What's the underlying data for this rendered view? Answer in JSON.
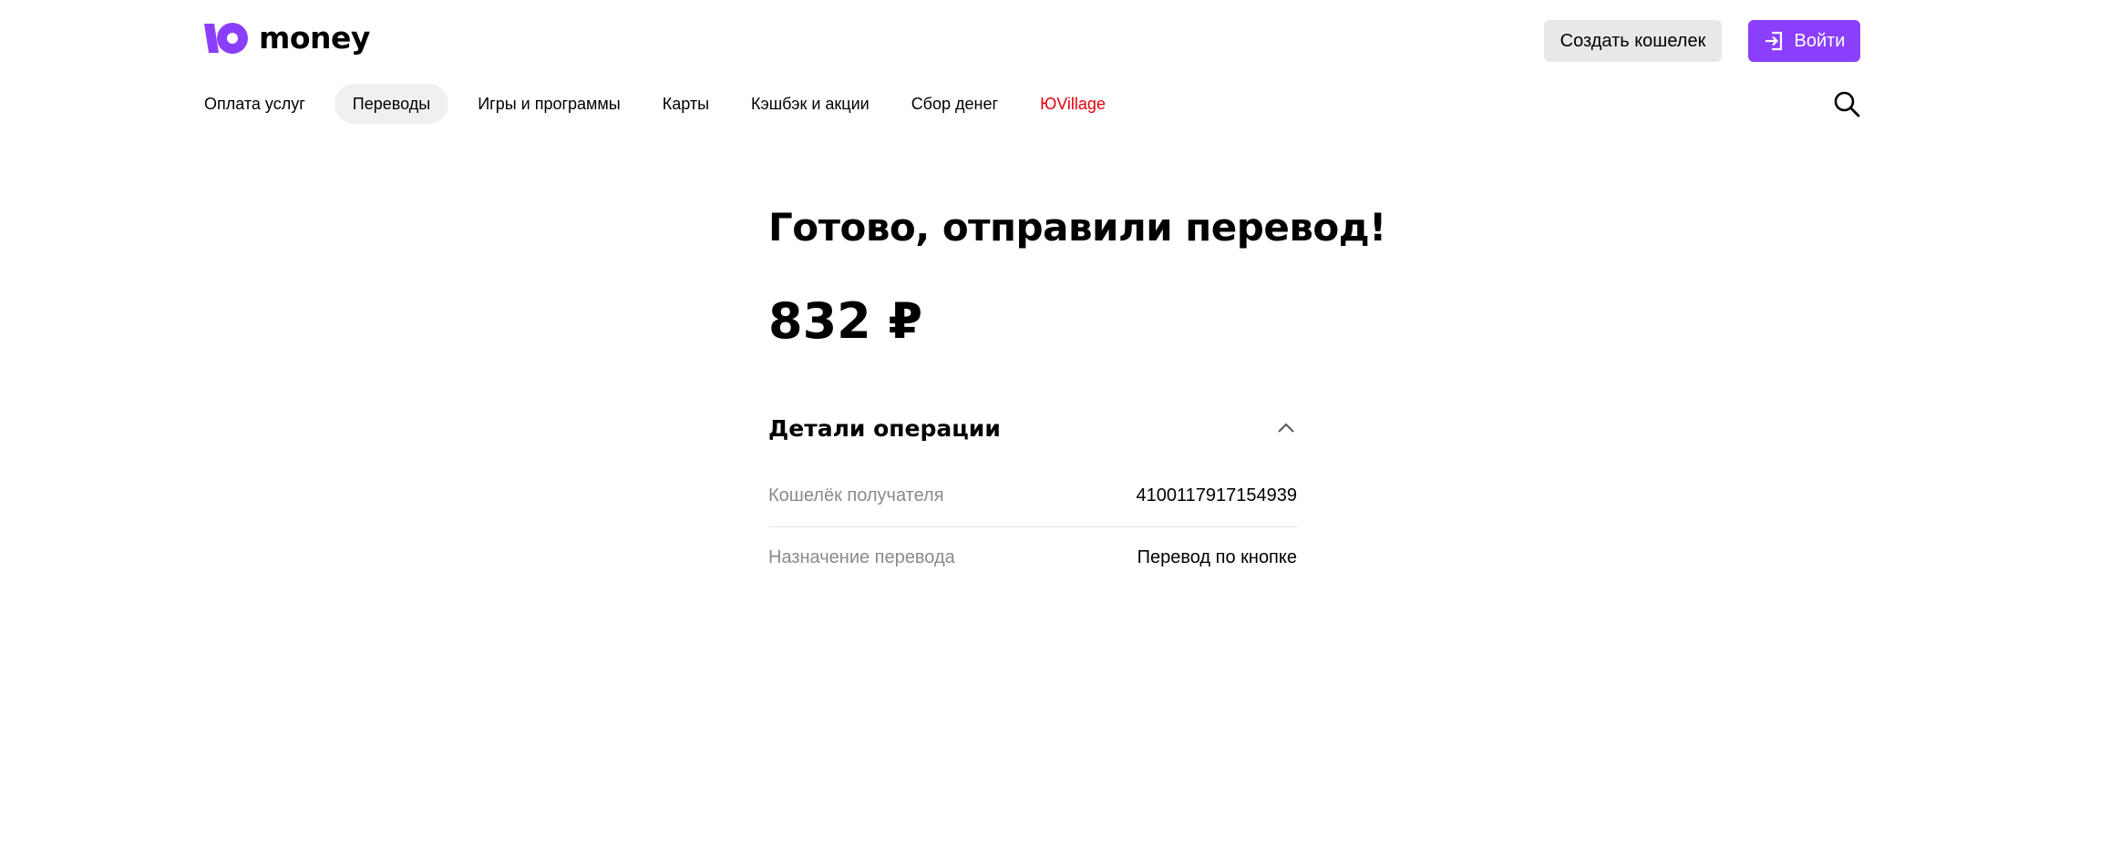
{
  "brand": {
    "logo_text": "money",
    "accent_color": "#8b3ffd"
  },
  "header": {
    "create_wallet_label": "Создать кошелек",
    "login_label": "Войти"
  },
  "nav": {
    "items": [
      {
        "label": "Оплата услуг"
      },
      {
        "label": "Переводы",
        "active": true
      },
      {
        "label": "Игры и программы"
      },
      {
        "label": "Карты"
      },
      {
        "label": "Кэшбэк и акции"
      },
      {
        "label": "Сбор денег"
      },
      {
        "label": "ЮVillage",
        "accent_color": "#e8000b"
      }
    ],
    "search_icon": "search-icon"
  },
  "result": {
    "title": "Готово, отправили перевод!",
    "amount": "832 ₽"
  },
  "details": {
    "title": "Детали операции",
    "expanded": true,
    "rows": [
      {
        "label": "Кошелёк получателя",
        "value": "4100117917154939"
      },
      {
        "label": "Назначение перевода",
        "value": "Перевод по кнопке"
      }
    ]
  }
}
